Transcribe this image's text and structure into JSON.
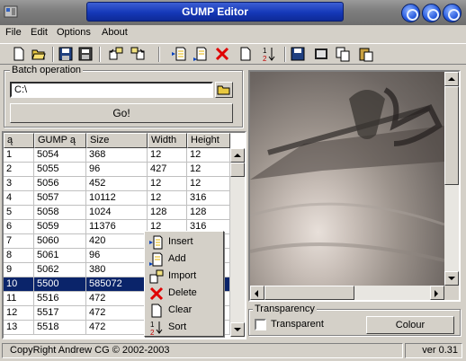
{
  "window": {
    "title": "GUMP Editor"
  },
  "menu": [
    "File",
    "Edit",
    "Options",
    "About"
  ],
  "toolbar": {
    "icons": [
      "new-icon",
      "open-icon",
      "save-icon",
      "save-all-icon",
      "import-icon",
      "export-icon",
      "insert-icon",
      "add-icon",
      "delete-icon",
      "clear-icon",
      "sort-icon",
      "save-file-icon",
      "film-icon",
      "copy-icon",
      "paste-icon"
    ]
  },
  "batch": {
    "label": "Batch operation",
    "path_value": "C:\\",
    "go_label": "Go!"
  },
  "table": {
    "headers": [
      "ą",
      "GUMP ą",
      "Size",
      "Width",
      "Height"
    ],
    "rows": [
      [
        "1",
        "5054",
        "368",
        "12",
        "12"
      ],
      [
        "2",
        "5055",
        "96",
        "427",
        "12"
      ],
      [
        "3",
        "5056",
        "452",
        "12",
        "12"
      ],
      [
        "4",
        "5057",
        "10112",
        "12",
        "316"
      ],
      [
        "5",
        "5058",
        "1024",
        "128",
        "128"
      ],
      [
        "6",
        "5059",
        "11376",
        "12",
        "316"
      ],
      [
        "7",
        "5060",
        "420",
        "",
        ""
      ],
      [
        "8",
        "5061",
        "96",
        "",
        ""
      ],
      [
        "9",
        "5062",
        "380",
        "",
        ""
      ],
      [
        "10",
        "5500",
        "585072",
        "",
        ""
      ],
      [
        "11",
        "5516",
        "472",
        "",
        ""
      ],
      [
        "12",
        "5517",
        "472",
        "",
        ""
      ],
      [
        "13",
        "5518",
        "472",
        "",
        ""
      ]
    ],
    "selected_row": 10
  },
  "context_menu": {
    "items": [
      {
        "label": "Insert",
        "icon": "insert-icon"
      },
      {
        "label": "Add",
        "icon": "add-icon"
      },
      {
        "label": "Import",
        "icon": "import-icon"
      },
      {
        "label": "Delete",
        "icon": "delete-icon"
      },
      {
        "label": "Clear",
        "icon": "clear-icon"
      },
      {
        "label": "Sort",
        "icon": "sort-icon"
      }
    ]
  },
  "transparency": {
    "label": "Transparency",
    "checkbox_label": "Transparent",
    "checked": false,
    "colour_label": "Colour"
  },
  "status": {
    "copyright": "CopyRight Andrew CG © 2002-2003",
    "version": "ver 0.31"
  },
  "colors": {
    "title_blue": "#1538b8",
    "selection": "#0a246a",
    "face": "#d4d0c8"
  }
}
